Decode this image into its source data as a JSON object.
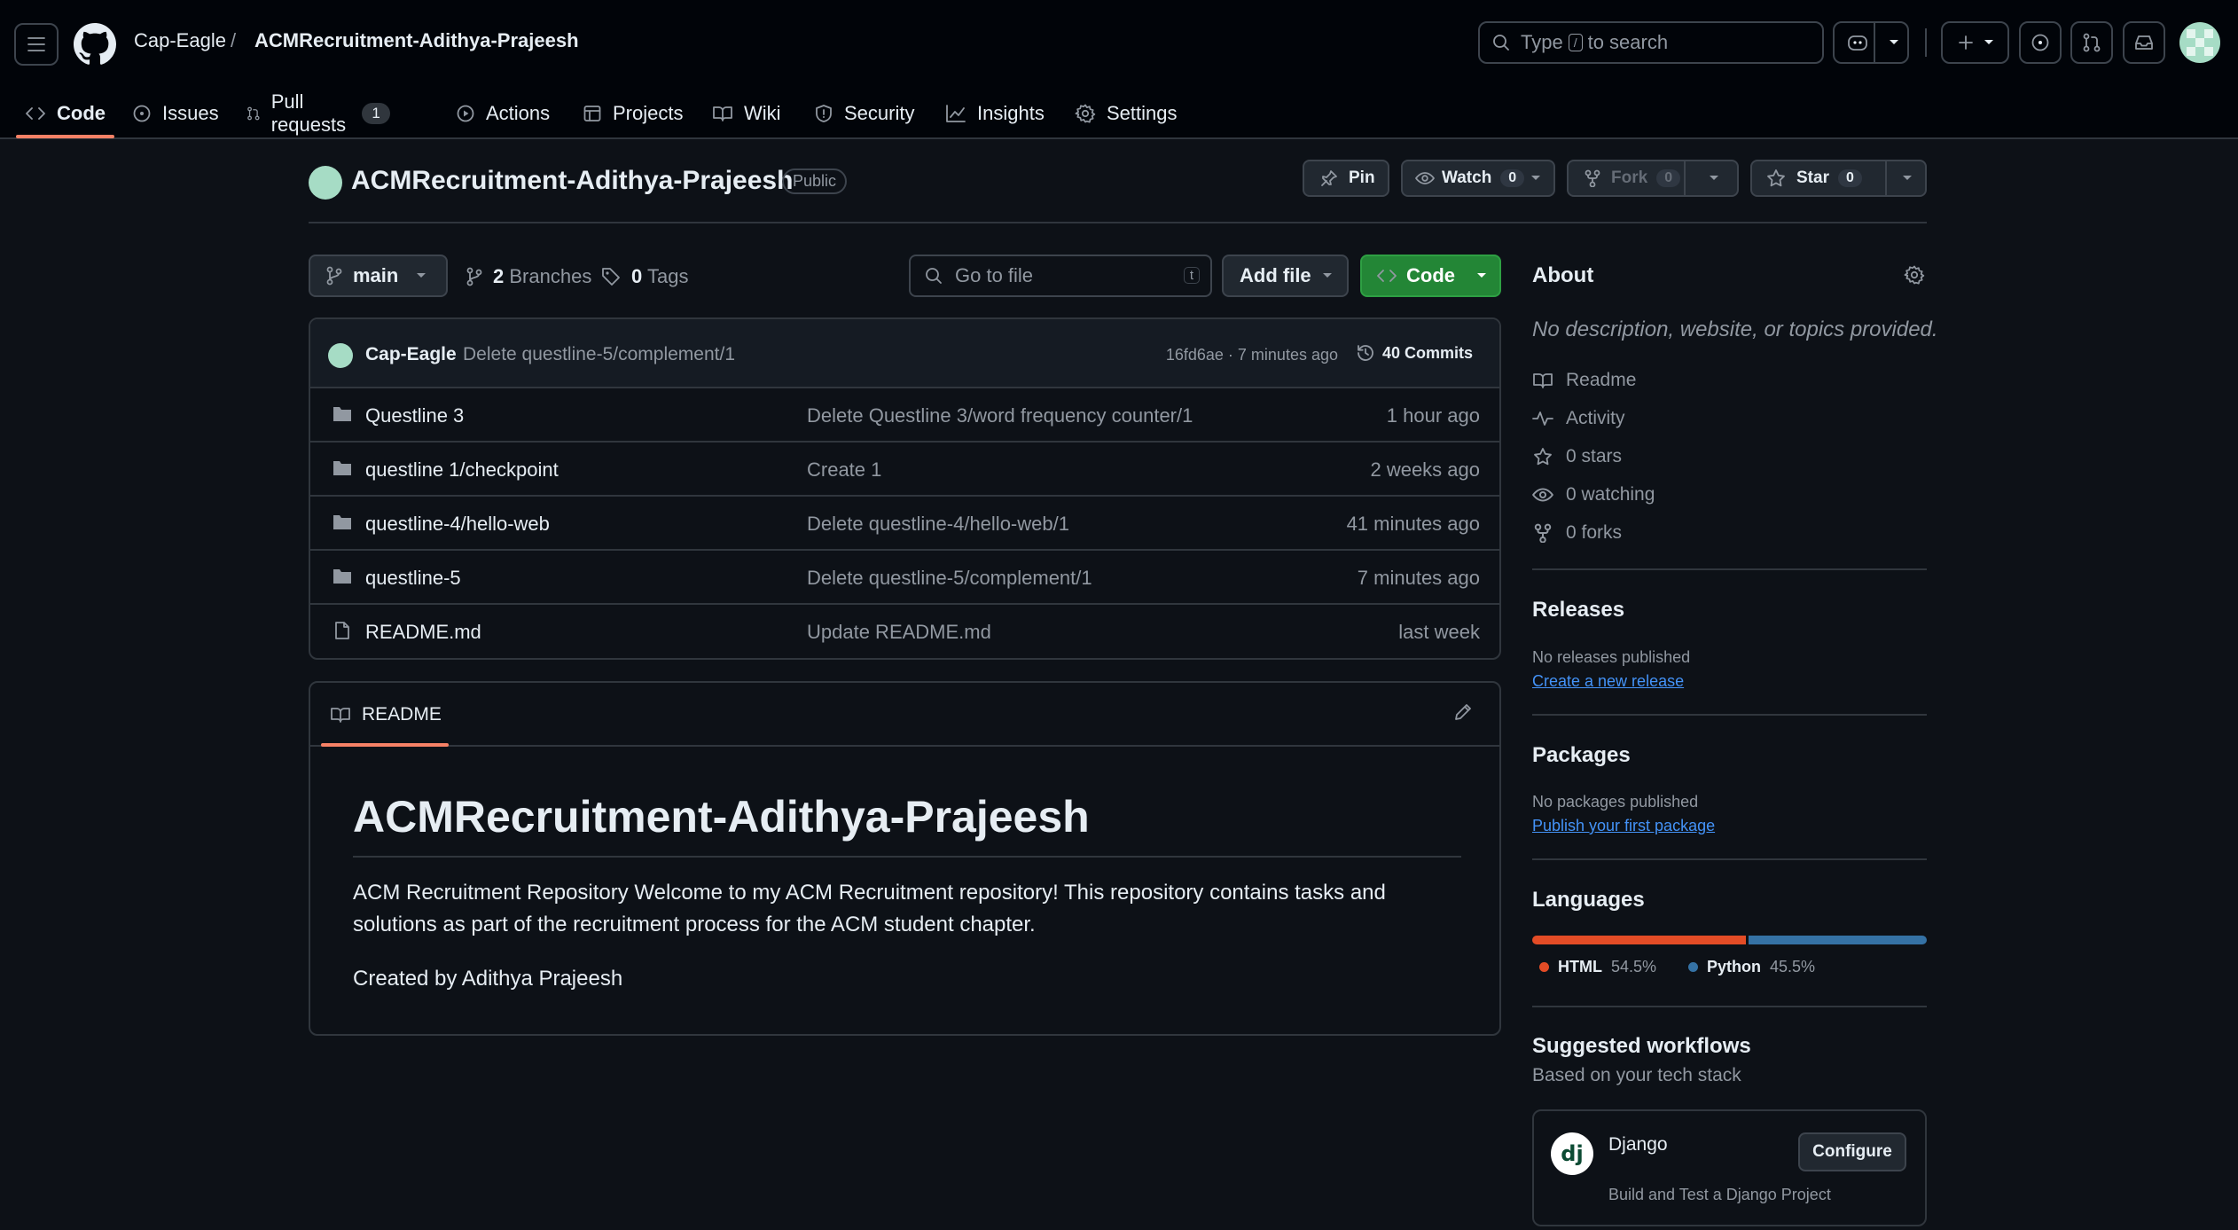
{
  "header": {
    "owner": "Cap-Eagle",
    "separator": "/",
    "repo": "ACMRecruitment-Adithya-Prajeesh",
    "search_prefix": "Type",
    "search_key": "/",
    "search_suffix": "to search"
  },
  "tabs": [
    {
      "label": "Code",
      "icon": "code-icon",
      "active": true
    },
    {
      "label": "Issues",
      "icon": "issue-icon"
    },
    {
      "label": "Pull requests",
      "icon": "pull-request-icon",
      "count": "1"
    },
    {
      "label": "Actions",
      "icon": "play-icon"
    },
    {
      "label": "Projects",
      "icon": "table-icon"
    },
    {
      "label": "Wiki",
      "icon": "book-icon"
    },
    {
      "label": "Security",
      "icon": "shield-icon"
    },
    {
      "label": "Insights",
      "icon": "graph-icon"
    },
    {
      "label": "Settings",
      "icon": "gear-icon"
    }
  ],
  "repo": {
    "name": "ACMRecruitment-Adithya-Prajeesh",
    "visibility": "Public",
    "pin_label": "Pin",
    "watch_label": "Watch",
    "watch_count": "0",
    "fork_label": "Fork",
    "fork_count": "0",
    "star_label": "Star",
    "star_count": "0"
  },
  "toolbar": {
    "branch": "main",
    "branches_count": "2",
    "branches_label": "Branches",
    "tags_count": "0",
    "tags_label": "Tags",
    "goto_placeholder": "Go to file",
    "goto_key": "t",
    "add_file": "Add file",
    "code": "Code"
  },
  "last_commit": {
    "user": "Cap-Eagle",
    "message": "Delete questline-5/complement/1",
    "hash_time": "16fd6ae · 7 minutes ago",
    "commits_label": "40 Commits"
  },
  "files": [
    {
      "type": "folder",
      "name": "Questline 3",
      "message": "Delete Questline 3/word frequency counter/1",
      "date": "1 hour ago"
    },
    {
      "type": "folder",
      "name": "questline 1/checkpoint",
      "message": "Create 1",
      "date": "2 weeks ago"
    },
    {
      "type": "folder",
      "name": "questline-4/hello-web",
      "message": "Delete questline-4/hello-web/1",
      "date": "41 minutes ago"
    },
    {
      "type": "folder",
      "name": "questline-5",
      "message": "Delete questline-5/complement/1",
      "date": "7 minutes ago"
    },
    {
      "type": "file",
      "name": "README.md",
      "message": "Update README.md",
      "date": "last week"
    }
  ],
  "readme": {
    "tab_label": "README",
    "title": "ACMRecruitment-Adithya-Prajeesh",
    "paragraph1": "ACM Recruitment Repository Welcome to my ACM Recruitment repository! This repository contains tasks and solutions as part of the recruitment process for the ACM student chapter.",
    "paragraph2": "Created by Adithya Prajeesh"
  },
  "about": {
    "title": "About",
    "description": "No description, website, or topics provided.",
    "items": [
      {
        "label": "Readme",
        "icon": "book-icon"
      },
      {
        "label": "Activity",
        "icon": "pulse-icon"
      },
      {
        "label": "0 stars",
        "icon": "star-icon"
      },
      {
        "label": "0 watching",
        "icon": "eye-icon"
      },
      {
        "label": "0 forks",
        "icon": "fork-icon"
      }
    ]
  },
  "releases": {
    "title": "Releases",
    "empty": "No releases published",
    "link": "Create a new release"
  },
  "packages": {
    "title": "Packages",
    "empty": "No packages published",
    "link": "Publish your first package"
  },
  "languages": {
    "title": "Languages",
    "items": [
      {
        "name": "HTML",
        "percent": "54.5%",
        "value": 54.5,
        "color": "#e34c26"
      },
      {
        "name": "Python",
        "percent": "45.5%",
        "value": 45.5,
        "color": "#3572a5"
      }
    ]
  },
  "workflows": {
    "title": "Suggested workflows",
    "subtitle": "Based on your tech stack",
    "card": {
      "name": "Django",
      "logo": "dj",
      "description": "Build and Test a Django Project",
      "button": "Configure"
    }
  },
  "colors": {
    "accent_underline": "#f78166",
    "code_button": "#238636",
    "link": "#4493f8",
    "background": "#0d1117"
  }
}
